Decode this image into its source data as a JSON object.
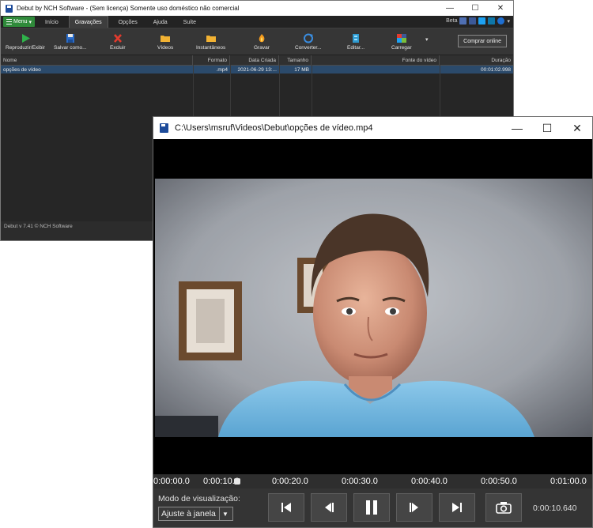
{
  "main_window": {
    "title": "Debut by NCH Software - (Sem licença) Somente uso doméstico não comercial",
    "menu_button": "Menu",
    "tabs": [
      "Início",
      "Gravações",
      "Opções",
      "Ajuda",
      "Suíte"
    ],
    "active_tab": "Gravações",
    "beta_label": "Beta",
    "toolbar": {
      "play": "Reproduzir/Exibir",
      "save": "Salvar como...",
      "delete": "Excluir",
      "videos": "Vídeos",
      "snapshots": "Instantâneos",
      "record": "Gravar",
      "convert": "Converter...",
      "edit": "Editar...",
      "upload": "Carregar"
    },
    "buy_button": "Comprar online",
    "table": {
      "headers": {
        "name": "Nome",
        "format": "Formato",
        "date": "Data Criada",
        "size": "Tamanho",
        "source": "Fonte do vídeo",
        "duration": "Duração"
      },
      "rows": [
        {
          "name": "opções de vídeo",
          "format": ".mp4",
          "date": "2021-06-29 13:...",
          "size": "17 MB",
          "source": "",
          "duration": "00:01:02.998"
        }
      ]
    },
    "status": "Debut v 7.41 © NCH Software"
  },
  "player_window": {
    "title": "C:\\Users\\msruf\\Videos\\Debut\\opções de vídeo.mp4",
    "timeline_labels": [
      "0:00:00.0",
      "0:00:10.0",
      "0:00:20.0",
      "0:00:30.0",
      "0:00:40.0",
      "0:00:50.0",
      "0:01:00.0"
    ],
    "playhead_seconds": 10.64,
    "view_mode_label": "Modo de visualização:",
    "view_mode_value": "Ajuste à janela",
    "time_display": "0:00:10.640"
  },
  "colors": {
    "accent_green": "#2f8a3a",
    "selection_blue": "#2b4a6b",
    "dark_bg": "#2c2c2c"
  },
  "icons": [
    "play-icon",
    "save-icon",
    "delete-icon",
    "folder-icon",
    "record-icon",
    "convert-icon",
    "edit-icon",
    "upload-icon",
    "thumbs-up-icon",
    "facebook-icon",
    "twitter-icon",
    "linkedin-icon",
    "help-icon",
    "skip-start-icon",
    "prev-frame-icon",
    "pause-icon",
    "next-frame-icon",
    "skip-end-icon",
    "snapshot-icon"
  ]
}
